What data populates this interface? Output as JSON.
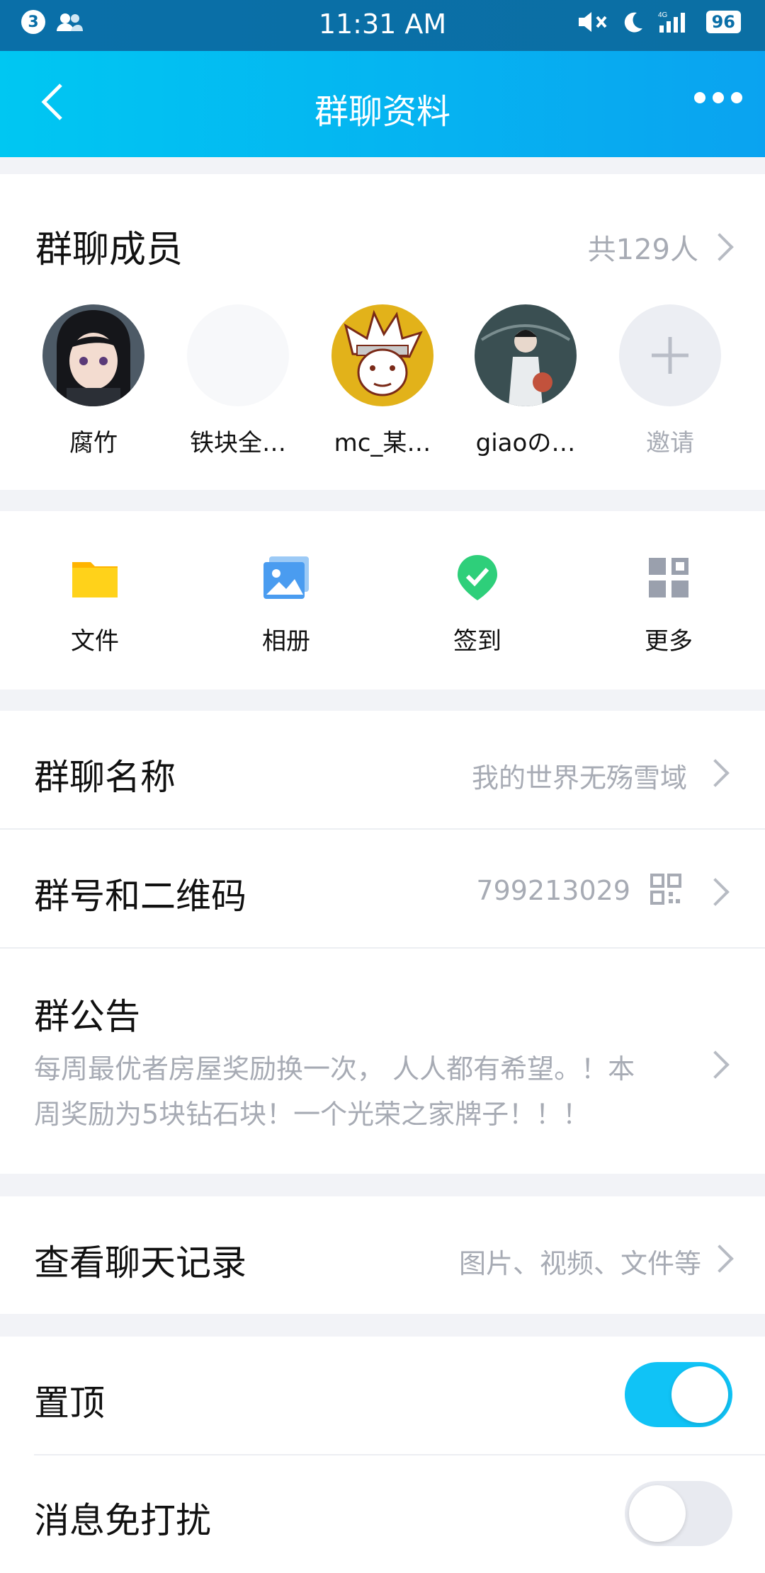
{
  "statusbar": {
    "notification_count": "3",
    "time": "11:31 AM",
    "network": "4G",
    "battery": "96",
    "icons": [
      "notification-badge",
      "contacts-icon",
      "mute-icon",
      "moon-icon",
      "signal-icon",
      "battery-icon"
    ]
  },
  "nav": {
    "title": "群聊资料",
    "back_icon": "chevron-left-icon",
    "more_icon": "more-dots-icon"
  },
  "members": {
    "title": "群聊成员",
    "count": "共129人",
    "items": [
      {
        "name": "腐竹",
        "avatar": "anime-girl-avatar"
      },
      {
        "name": "铁块全…",
        "avatar": "blank-avatar"
      },
      {
        "name": "mc_某…",
        "avatar": "naruto-avatar"
      },
      {
        "name": "giaoの…",
        "avatar": "boy-umbrella-avatar"
      },
      {
        "name": "邀请",
        "avatar": "plus-icon"
      }
    ]
  },
  "quick_actions": [
    {
      "label": "文件",
      "icon": "folder-icon",
      "color": "#ffb400"
    },
    {
      "label": "相册",
      "icon": "album-icon",
      "color": "#4a9cf0"
    },
    {
      "label": "签到",
      "icon": "checkin-icon",
      "color": "#2ecf7a"
    },
    {
      "label": "更多",
      "icon": "grid-more-icon",
      "color": "#9aa0ad"
    }
  ],
  "settings": {
    "group_name": {
      "label": "群聊名称",
      "value": "我的世界无殇雪域"
    },
    "group_id": {
      "label": "群号和二维码",
      "value": "799213029"
    },
    "announcement": {
      "label": "群公告",
      "line1": "每周最优者房屋奖励换一次，  人人都有希望。！本",
      "line2": "周奖励为5块钻石块！一个光荣之家牌子！！！"
    },
    "history": {
      "label": "查看聊天记录",
      "value": "图片、视频、文件等"
    },
    "pin": {
      "label": "置顶",
      "on": true
    },
    "mute": {
      "label": "消息免打扰",
      "on": false
    }
  },
  "colors": {
    "accent": "#00c7f2",
    "toggle_on": "#10c3f6",
    "toggle_off": "#e8eaf0"
  }
}
